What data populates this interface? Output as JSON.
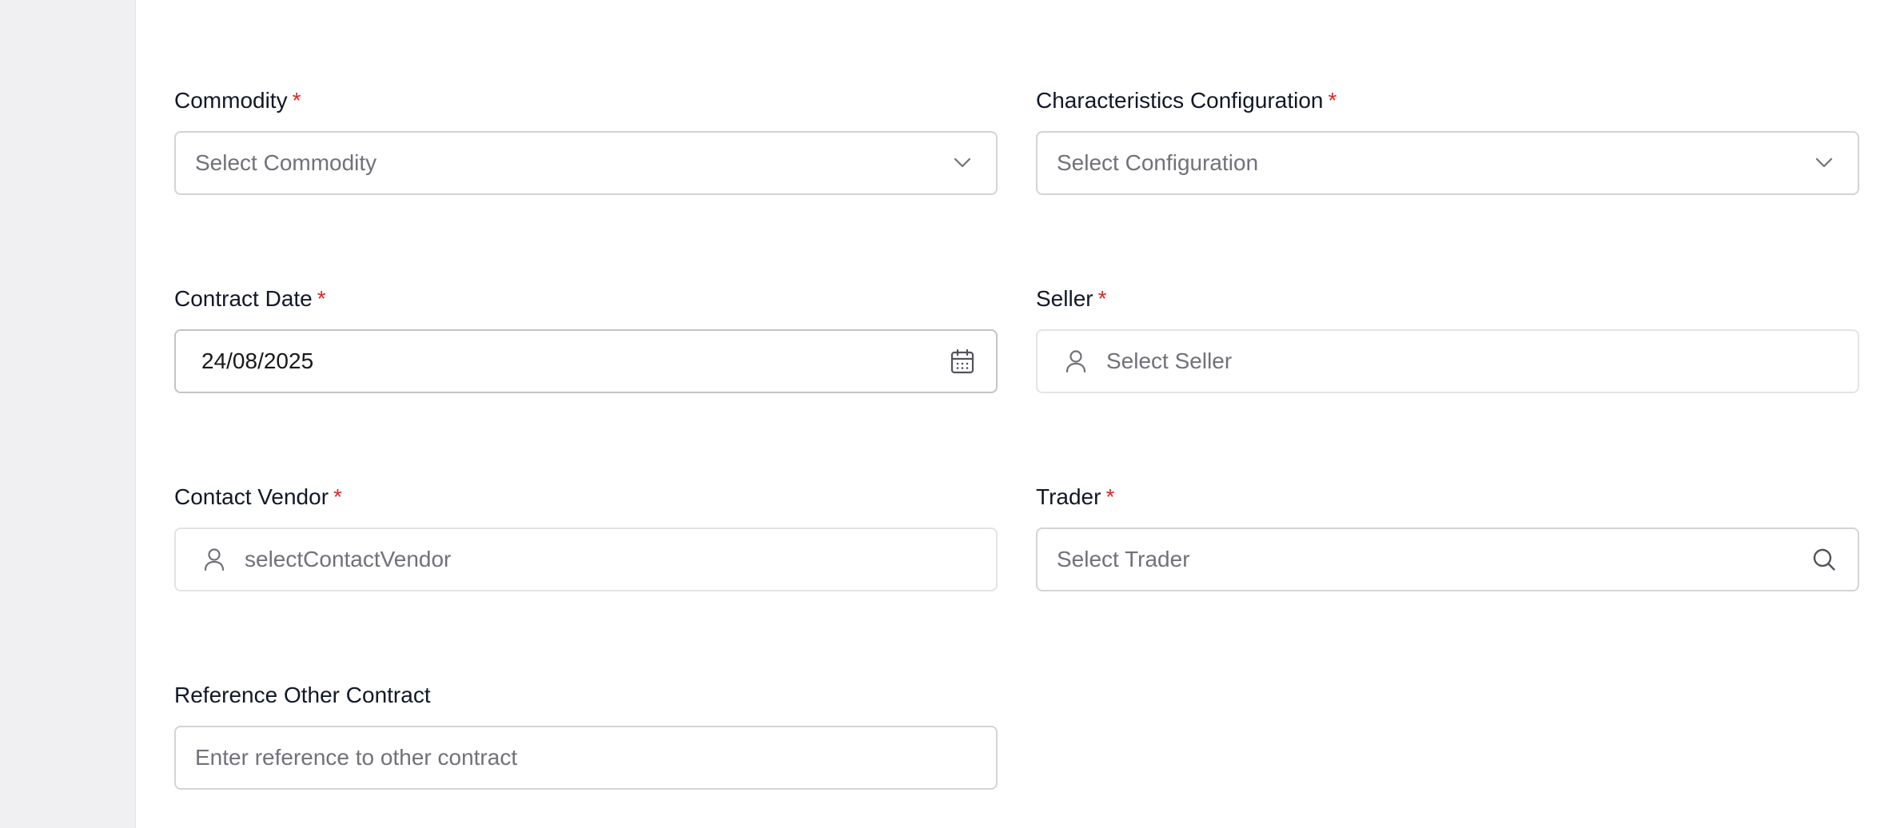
{
  "form": {
    "commodity": {
      "label": "Commodity",
      "required": "*",
      "placeholder": "Select Commodity",
      "icon": "chevron-down-icon"
    },
    "characteristics_configuration": {
      "label": "Characteristics Configuration",
      "required": "*",
      "placeholder": "Select Configuration",
      "icon": "chevron-down-icon"
    },
    "contract_date": {
      "label": "Contract Date",
      "required": "*",
      "value": "24/08/2025",
      "icon": "calendar-icon"
    },
    "seller": {
      "label": "Seller",
      "required": "*",
      "placeholder": "Select Seller",
      "icon": "user-icon"
    },
    "contact_vendor": {
      "label": "Contact Vendor",
      "required": "*",
      "placeholder": "selectContactVendor",
      "icon": "user-icon"
    },
    "trader": {
      "label": "Trader",
      "required": "*",
      "placeholder": "Select Trader",
      "icon": "search-icon"
    },
    "reference_other_contract": {
      "label": "Reference Other Contract",
      "placeholder": "Enter reference to other contract"
    }
  },
  "colors": {
    "required_asterisk": "#dc2626",
    "border": "#d4d4d8",
    "sidebar_bg": "#f0f0f2",
    "placeholder_text": "#71717a",
    "label_text": "#111827"
  }
}
